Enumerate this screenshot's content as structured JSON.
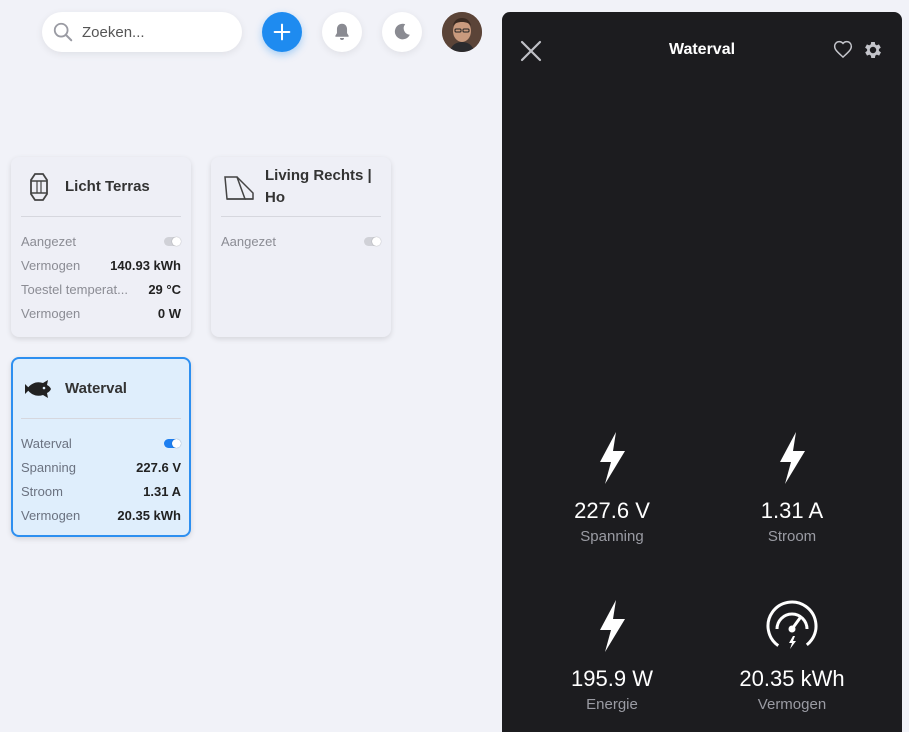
{
  "search": {
    "placeholder": "Zoeken..."
  },
  "toolbar": {
    "add_icon": "plus-icon",
    "notifications_icon": "bell-icon",
    "theme_icon": "moon-icon",
    "accent": "#1e8bf0"
  },
  "cards": [
    {
      "title": "Licht Terras",
      "icon": "lantern-icon",
      "rows": [
        {
          "label": "Aangezet",
          "toggle": false
        },
        {
          "label": "Vermogen",
          "value": "140.93 kWh"
        },
        {
          "label": "Toestel temperat...",
          "value": "29 °C"
        },
        {
          "label": "Vermogen",
          "value": "0 W"
        }
      ]
    },
    {
      "title": "Living Rechts | Ho",
      "icon": "floor-lamp-icon",
      "rows": [
        {
          "label": "Aangezet",
          "toggle": false
        }
      ]
    },
    {
      "title": "Waterval",
      "icon": "fish-icon",
      "selected": true,
      "rows": [
        {
          "label": "Waterval",
          "toggle": true
        },
        {
          "label": "Spanning",
          "value": "227.6 V"
        },
        {
          "label": "Stroom",
          "value": "1.31 A"
        },
        {
          "label": "Vermogen",
          "value": "20.35 kWh"
        }
      ]
    }
  ],
  "panel": {
    "title": "Waterval",
    "metrics": [
      {
        "value": "227.6 V",
        "label": "Spanning",
        "icon": "lightning-icon"
      },
      {
        "value": "1.31 A",
        "label": "Stroom",
        "icon": "lightning-icon"
      },
      {
        "value": "195.9 W",
        "label": "Energie",
        "icon": "lightning-icon"
      },
      {
        "value": "20.35 kWh",
        "label": "Vermogen",
        "icon": "gauge-icon"
      }
    ]
  }
}
